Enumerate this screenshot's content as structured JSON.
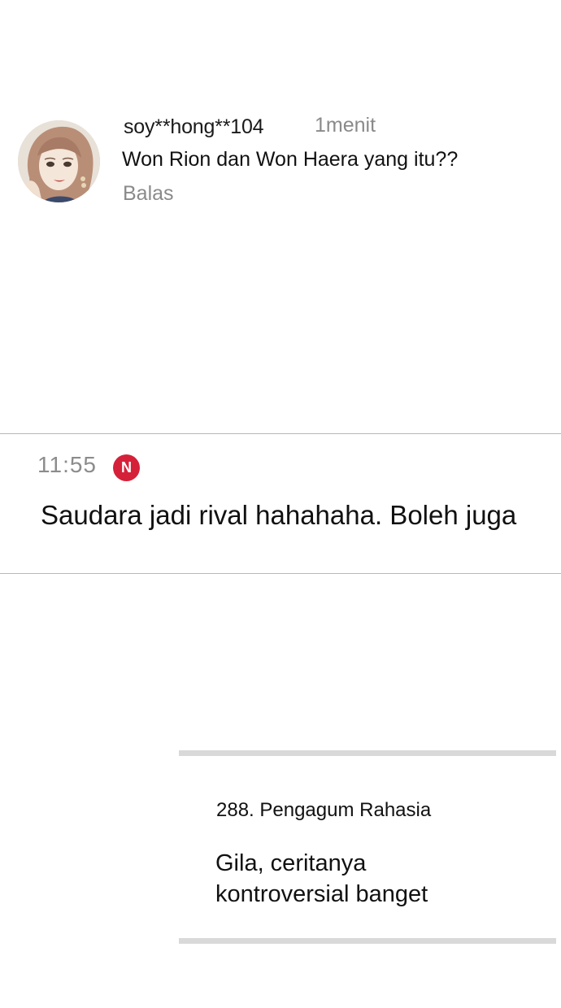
{
  "comment": {
    "avatar_icon": "user-avatar-illustrated-woman",
    "username": "soy**hong**104",
    "time_ago": "1menit",
    "text": "Won Rion dan Won Haera yang itu??",
    "reply_label": "Balas"
  },
  "notification": {
    "time": "11:55",
    "badge": "N",
    "badge_color": "#d5203a",
    "message": "Saudara jadi rival hahahaha. Boleh juga"
  },
  "card": {
    "author": "288. Pengagum Rahasia",
    "text_lines": [
      "Gila, ceritanya",
      "kontroversial banget"
    ]
  }
}
